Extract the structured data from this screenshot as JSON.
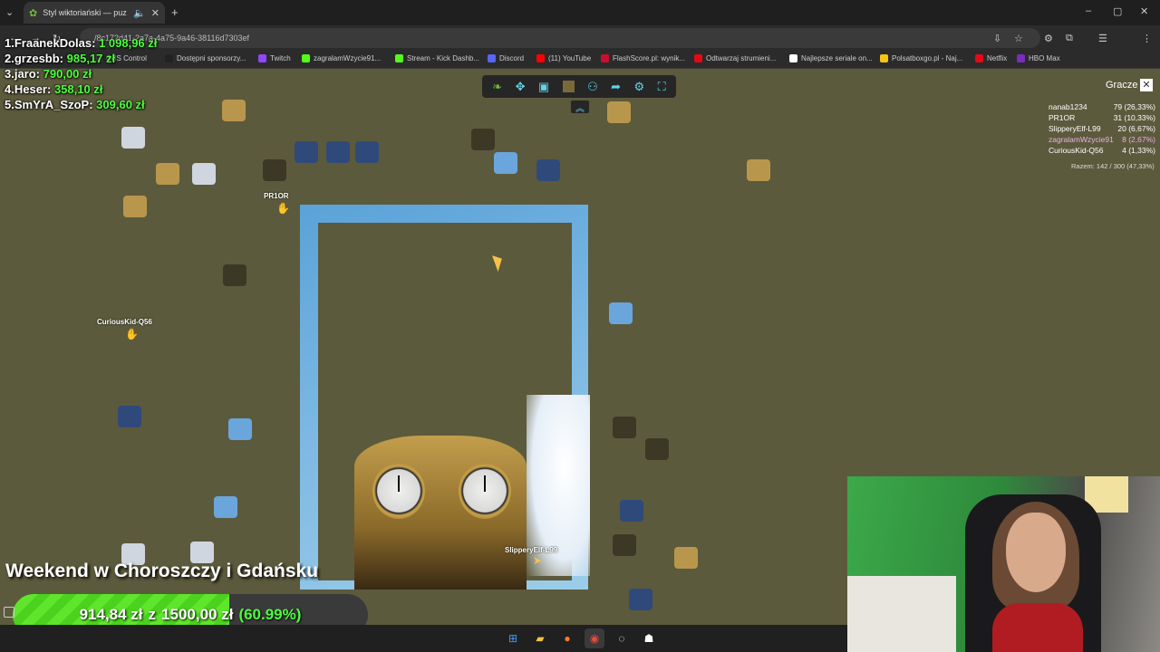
{
  "browser": {
    "tab_title": "Styl wiktoriański — puz",
    "url": "/8c172d41-2a7a-4a75-9a46-38116d7303ef",
    "bookmarks": [
      {
        "label": "OBS Control",
        "color": "#444444"
      },
      {
        "label": "Dostępni sponsorzy...",
        "color": "#222222"
      },
      {
        "label": "Twitch",
        "color": "#9146ff"
      },
      {
        "label": "zagralamWzycie91...",
        "color": "#53fc18"
      },
      {
        "label": "Stream - Kick Dashb...",
        "color": "#53fc18"
      },
      {
        "label": "Discord",
        "color": "#5865f2"
      },
      {
        "label": "(11) YouTube",
        "color": "#ff0000"
      },
      {
        "label": "FlashScore.pl: wynik...",
        "color": "#c8102e"
      },
      {
        "label": "Odtwarzaj strumieni...",
        "color": "#e50914"
      },
      {
        "label": "Najlepsze seriale on...",
        "color": "#ffffff"
      },
      {
        "label": "Polsatboxgo.pl - Naj...",
        "color": "#f5c518"
      },
      {
        "label": "Netflix",
        "color": "#e50914"
      },
      {
        "label": "HBO Max",
        "color": "#7b2cbf"
      }
    ],
    "profile_initial": "K"
  },
  "leaderboard": [
    {
      "rank_name": "1.FraanekDolas:",
      "amount": "1 098,96 zł"
    },
    {
      "rank_name": "2.grzesbb:",
      "amount": "985,17 zł"
    },
    {
      "rank_name": "3.jaro:",
      "amount": "790,00 zł"
    },
    {
      "rank_name": "4.Heser:",
      "amount": "358,10 zł"
    },
    {
      "rank_name": "5.SmYrA_SzoP:",
      "amount": "309,60 zł"
    }
  ],
  "players_panel": {
    "title": "Gracze",
    "rows": [
      {
        "name": "nanab1234",
        "score": "79 (26,33%)"
      },
      {
        "name": "PR1OR",
        "score": "31 (10,33%)"
      },
      {
        "name": "SlipperyElf-L99",
        "score": "20 (6,67%)"
      },
      {
        "name": "zagralamWzycie91",
        "score": "8 (2,67%)"
      },
      {
        "name": "CuriousKid-Q56",
        "score": "4 (1,33%)"
      }
    ],
    "total": "Razem: 142 / 300 (47,33%)"
  },
  "cursors": {
    "prior": "PR1OR",
    "curious": "CuriousKid-Q56",
    "slippery": "SlipperyElf-L99"
  },
  "goal": {
    "title": "Weekend w Choroszczy i Gdańsku",
    "current": "914,84 zł",
    "separator": "z",
    "target": "1500,00 zł",
    "percent_label": "(60.99%)",
    "progress": 0.6099
  },
  "colors": {
    "accent_green": "#4cff3c",
    "toolbar_icon": "#5fd6e8",
    "highlight_player": "#e9b0e8"
  },
  "toolbar_icons": [
    "leaf-icon",
    "puzzle-icon",
    "preview-icon",
    "background-icon",
    "players-icon",
    "share-icon",
    "settings-icon",
    "fullscreen-icon"
  ]
}
